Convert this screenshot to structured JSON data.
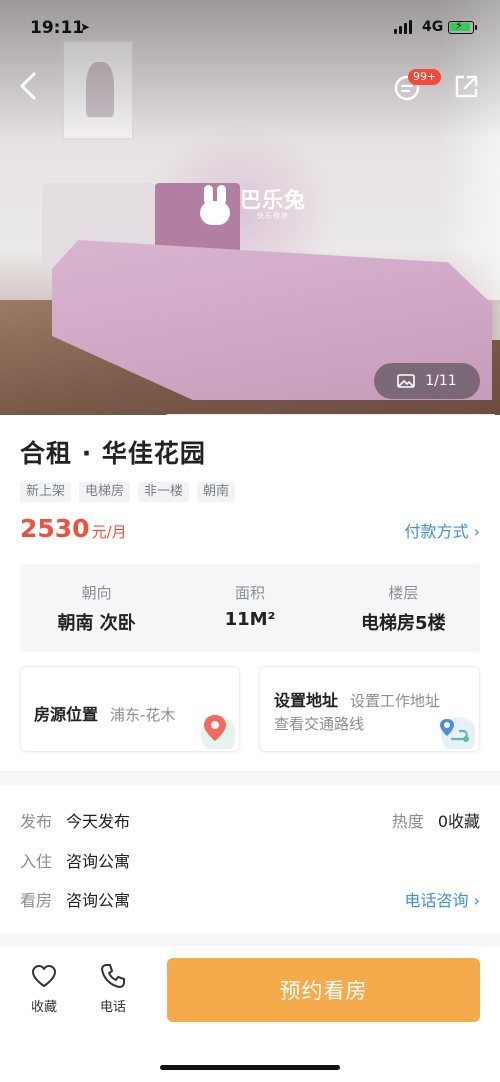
{
  "status_bar": {
    "time": "19:11",
    "network": "4G"
  },
  "hero": {
    "brand_name": "巴乐兔",
    "brand_sub": "快乐租房",
    "message_badge": "99+",
    "photo_counter": "1/11"
  },
  "listing": {
    "title": "合租 · 华佳花园",
    "tags": [
      "新上架",
      "电梯房",
      "非一楼",
      "朝南"
    ],
    "price_value": "2530",
    "price_unit": "元/月",
    "payment_link": "付款方式",
    "facts": [
      {
        "label": "朝向",
        "value": "朝南 次卧"
      },
      {
        "label": "面积",
        "value": "11M²"
      },
      {
        "label": "楼层",
        "value": "电梯房5楼"
      }
    ]
  },
  "location_card": {
    "title": "房源位置",
    "value": "浦东-花木"
  },
  "commute_card": {
    "title": "设置地址",
    "hint": "设置工作地址",
    "sub": "查看交通路线"
  },
  "details": {
    "publish": {
      "label": "发布",
      "value": "今天发布"
    },
    "heat": {
      "label": "热度",
      "value": "0收藏"
    },
    "movein": {
      "label": "入住",
      "value": "咨询公寓"
    },
    "viewing": {
      "label": "看房",
      "value": "咨询公寓"
    },
    "phone_link": "电话咨询"
  },
  "bottom_bar": {
    "favorite_label": "收藏",
    "phone_label": "电话",
    "book_button": "预约看房"
  },
  "colors": {
    "price_red": "#f0513f",
    "link_blue": "#3d8fe0",
    "book_orange": "#f5ab4b",
    "badge_red": "#f04a3a"
  }
}
